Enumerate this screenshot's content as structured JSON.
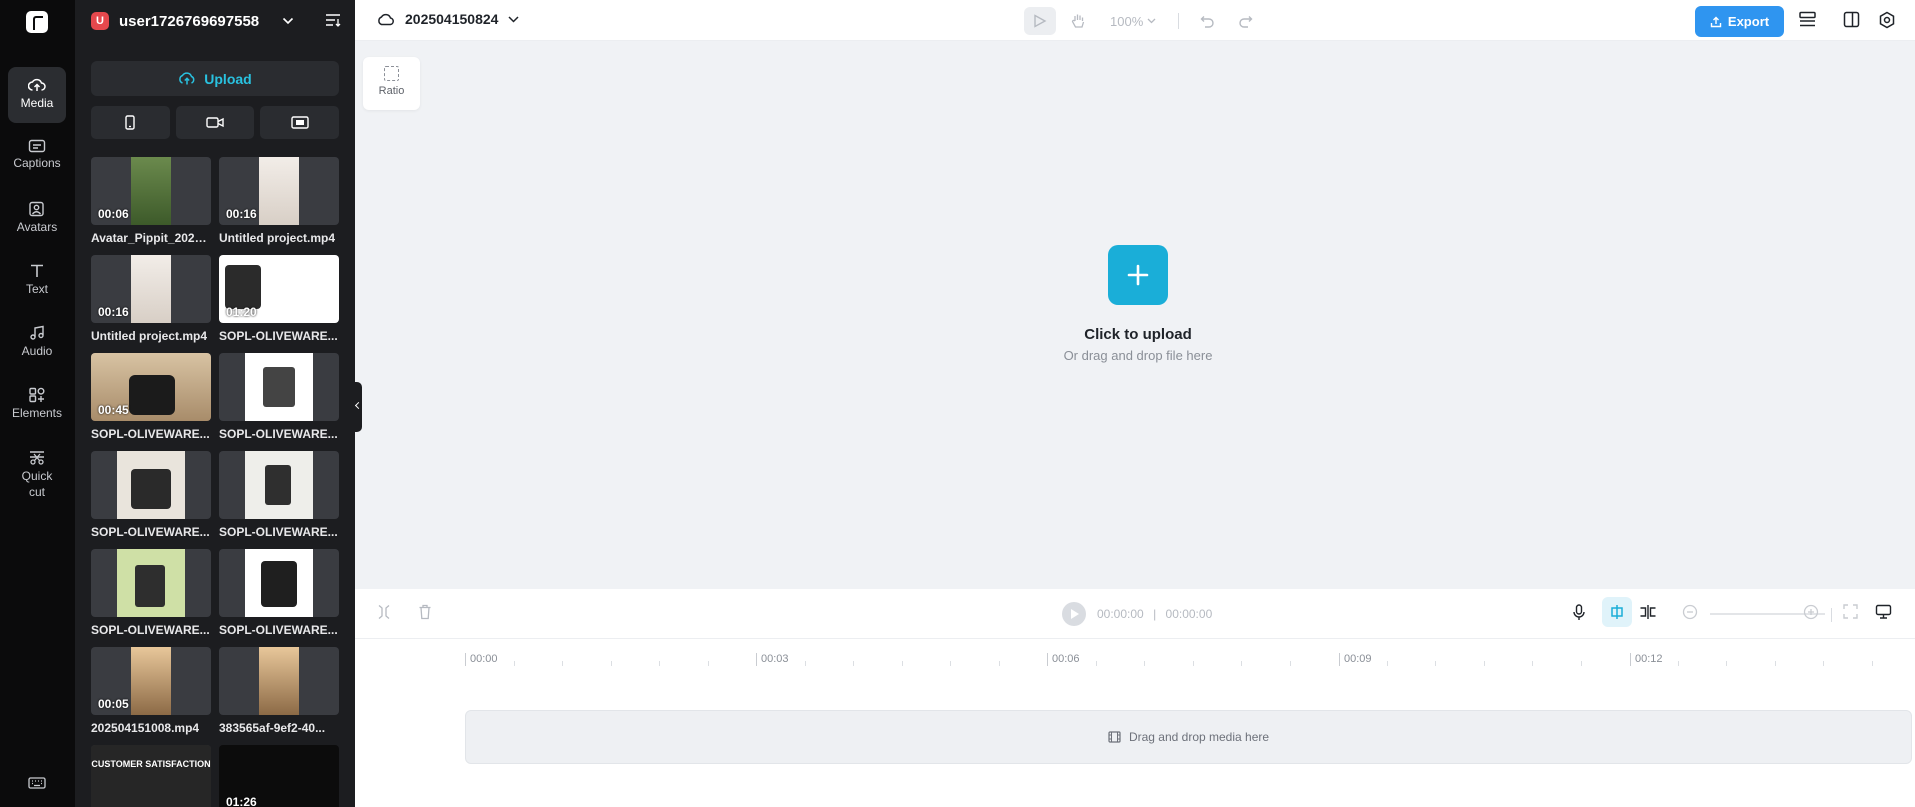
{
  "rail": {
    "items": [
      {
        "label": "Media",
        "icon": "cloud-upload-icon"
      },
      {
        "label": "Captions",
        "icon": "captions-icon"
      },
      {
        "label": "Avatars",
        "icon": "avatar-icon"
      },
      {
        "label": "Text",
        "icon": "text-icon"
      },
      {
        "label": "Audio",
        "icon": "music-note-icon"
      },
      {
        "label": "Elements",
        "icon": "elements-icon"
      },
      {
        "label": "Quick cut",
        "icon": "scissors-icon"
      }
    ],
    "active": "Media"
  },
  "panel": {
    "user_initial": "U",
    "user_name": "user1726769697558",
    "upload_label": "Upload",
    "media": [
      {
        "name": "Avatar_Pippit_2025...",
        "duration": "00:06"
      },
      {
        "name": "Untitled project.mp4",
        "duration": "00:16"
      },
      {
        "name": "Untitled project.mp4",
        "duration": "00:16"
      },
      {
        "name": "SOPL-OLIVEWARE...",
        "duration": "01:20"
      },
      {
        "name": "SOPL-OLIVEWARE...",
        "duration": "00:45"
      },
      {
        "name": "SOPL-OLIVEWARE...",
        "duration": ""
      },
      {
        "name": "SOPL-OLIVEWARE...",
        "duration": ""
      },
      {
        "name": "SOPL-OLIVEWARE...",
        "duration": ""
      },
      {
        "name": "SOPL-OLIVEWARE...",
        "duration": ""
      },
      {
        "name": "SOPL-OLIVEWARE...",
        "duration": ""
      },
      {
        "name": "202504151008.mp4",
        "duration": "00:05"
      },
      {
        "name": "383565af-9ef2-40...",
        "duration": ""
      },
      {
        "name": "",
        "duration": "",
        "overlay": "CUSTOMER SATISFACTION"
      },
      {
        "name": "",
        "duration": "01:26"
      }
    ]
  },
  "topbar": {
    "project_name": "202504150824",
    "zoom": "100%",
    "export_label": "Export"
  },
  "canvas": {
    "ratio_label": "Ratio",
    "upload_title": "Click to upload",
    "upload_hint": "Or drag and drop file here"
  },
  "timeline": {
    "current_time": "00:00:00",
    "total_time": "00:00:00",
    "ticks": [
      "00:00",
      "00:03",
      "00:06",
      "00:09",
      "00:12"
    ],
    "drop_hint": "Drag and drop media here"
  },
  "colors": {
    "accent": "#1aaed8",
    "export": "#2f95f0",
    "user_badge": "#e5484d"
  }
}
